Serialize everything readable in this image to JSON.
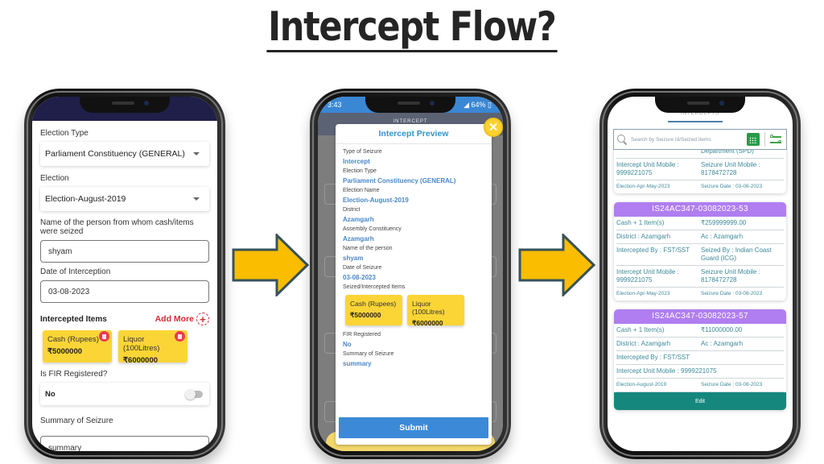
{
  "title": "Intercept Flow?",
  "colors": {
    "arrow_fill": "#fbbd00",
    "arrow_stroke": "#37535a",
    "chip_yellow": "#fbd535",
    "accent_red": "#d62834",
    "preview_blue": "#3c8ad7",
    "card_purple": "#b07ef0",
    "edit_teal": "#15877d"
  },
  "form_screen": {
    "election_type_label": "Election Type",
    "election_type_value": "Parliament Constituency (GENERAL)",
    "election_label": "Election",
    "election_value": "Election-August-2019",
    "person_label": "Name of the person from whom cash/items were seized",
    "person_value": "shyam",
    "date_label": "Date of Interception",
    "date_value": "03-08-2023",
    "items_heading": "Intercepted Items",
    "add_more_label": "Add More",
    "items": [
      {
        "name": "Cash (Rupees)",
        "value": "₹5000000"
      },
      {
        "name": "Liquor (100Litres)",
        "value": "₹6000000"
      }
    ],
    "fir_label": "Is FIR Registered?",
    "fir_value": "No",
    "summary_label": "Summary of Seizure",
    "summary_value": "summary"
  },
  "preview_screen": {
    "status_time": "3:43",
    "status_battery": "64%",
    "appbar_title": "INTERCEPT",
    "modal_title": "Intercept Preview",
    "fields": [
      {
        "label": "Type of Seizure",
        "value": "Intercept"
      },
      {
        "label": "Election Type",
        "value": "Parliament Constituency (GENERAL)"
      },
      {
        "label": "Election Name",
        "value": "Election-August-2019"
      },
      {
        "label": "District",
        "value": "Azamgarh"
      },
      {
        "label": "Assembly Constituency",
        "value": "Azamgarh"
      },
      {
        "label": "Name of the person",
        "value": "shyam"
      },
      {
        "label": "Date of Seizure",
        "value": "03-08-2023"
      }
    ],
    "items_label": "Seized/Intercepted Items",
    "items": [
      {
        "name": "Cash (Rupees)",
        "value": "₹5000000"
      },
      {
        "name": "Liquor (100Litres)",
        "value": "₹6000000"
      }
    ],
    "fir_label": "FIR Registered",
    "fir_value": "No",
    "summary_label": "Summary of Seizure",
    "summary_value": "summary",
    "submit_label": "Submit"
  },
  "list_screen": {
    "page_title": "INTERCEPTS",
    "search_placeholder": "Search by Seizure Id/Seized Items",
    "partial_card": {
      "dept_text": "Department (SPD)",
      "intercept_mobile": "Intercept Unit Mobile : 9999221075",
      "seizure_mobile": "Seizure Unit Mobile : 8178472728",
      "election": "Election-Apr-May-2023",
      "seizure_date": "Seizure Date : 03-08-2023"
    },
    "cards": [
      {
        "id": "IS24AC347-03082023-53",
        "items": "Cash + 1 Item(s)",
        "amount": "₹259999999.00",
        "district": "District : Azamgarh",
        "ac": "Ac : Azamgarh",
        "intercepted_by": "Intercepted By : FST/SST",
        "seized_by": "Seized By : Indian Coast Guard (ICG)",
        "intercept_mobile": "Intercept Unit Mobile : 9999221075",
        "seizure_mobile": "Seizure Unit Mobile : 8178472728",
        "election": "Election-Apr-May-2023",
        "seizure_date": "Seizure Date : 03-08-2023"
      },
      {
        "id": "IS24AC347-03082023-57",
        "items": "Cash + 1 Item(s)",
        "amount": "₹11000000.00",
        "district": "District : Azamgarh",
        "ac": "Ac : Azamgarh",
        "intercepted_by": "Intercepted By : FST/SST",
        "intercept_mobile": "Intercept Unit Mobile : 9999221075",
        "election": "Election-August-2019",
        "seizure_date": "Seizure Date : 03-08-2023",
        "edit_label": "Edit"
      }
    ]
  }
}
